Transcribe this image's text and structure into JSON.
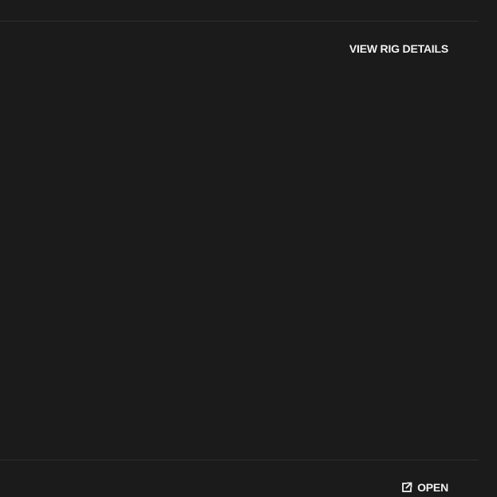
{
  "panel": {
    "view_rig_details_label": "VIEW RIG DETAILS",
    "open_label": "OPEN",
    "open_icon": "external-link-icon"
  },
  "colors": {
    "background": "#1b1b1b",
    "divider": "#2e2e2e",
    "text": "#f2f2f2"
  }
}
